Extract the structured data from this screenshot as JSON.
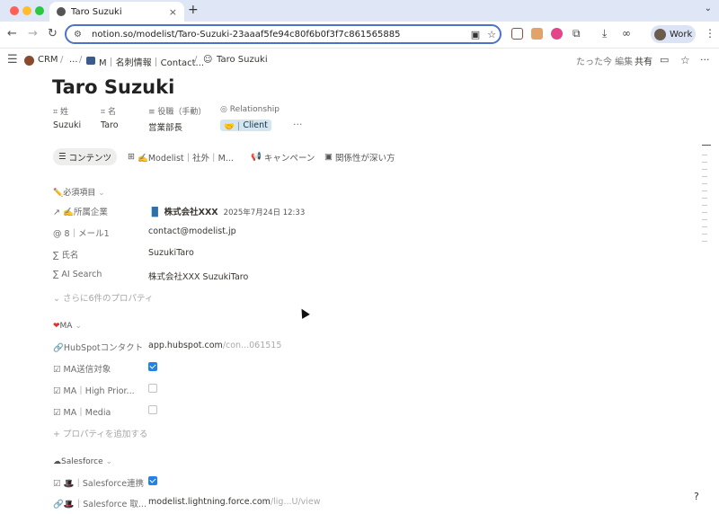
{
  "browser": {
    "tab_title": "Taro Suzuki",
    "tab_close": "×",
    "new_tab": "+",
    "tab_menu": "⌄",
    "url": "notion.so/modelist/Taro-Suzuki-23aaaf5fe94c80f6b0f3f7c861565885",
    "profile": "Work",
    "colors": {
      "chrome_bg": "#dfe7f6",
      "omnibox_border": "#4b73c9"
    }
  },
  "notion_topbar": {
    "crumbs": [
      "CRM",
      "...",
      "M｜名刺情報｜Contact...",
      "Taro Suzuki"
    ],
    "separators": [
      "/",
      "/",
      "/"
    ],
    "edited": "たった今 編集",
    "share": "共有"
  },
  "page": {
    "title": "Taro Suzuki",
    "prop_headers": [
      "姓",
      "名",
      "役職（手動）",
      "Relationship"
    ],
    "prop_values": [
      "Suzuki",
      "Taro",
      "営業部長"
    ],
    "relationship_tag": "Client",
    "more_menu": "···",
    "view_tabs": [
      "コンテンツ",
      "✍️Modelist｜社外｜M...",
      "キャンペーン",
      "関係性が深い方"
    ],
    "section_required": "必須項目",
    "required_rows": [
      {
        "label": "✍️所属企業",
        "value": "株式会社XXX",
        "extra": "2025年7月24日 12:33"
      },
      {
        "label": "8｜メール1",
        "value": "contact@modelist.jp"
      },
      {
        "label": "氏名",
        "value": "SuzukiTaro"
      },
      {
        "label": "AI Search",
        "value": "株式会社XXX SuzukiTaro"
      }
    ],
    "more_props": "さらに6件のプロパティ",
    "section_ma": "MA",
    "ma_url_label": "HubSpotコンタクト",
    "ma_url_value": "app.hubspot.com",
    "ma_url_rest": "/con...061515",
    "ma_checkboxes": [
      {
        "label": "MA送信対象",
        "checked": true
      },
      {
        "label": "MA｜High Prior...",
        "checked": false
      },
      {
        "label": "MA｜Media",
        "checked": false
      }
    ],
    "add_property": "プロパティを追加する",
    "section_sf": "Salesforce",
    "sf_checkbox_label": "｜Salesforce連携",
    "sf_url_label": "｜Salesforce 取...",
    "sf_url_value": "modelist.lightning.force.com",
    "sf_url_rest": "/lig...U/view",
    "help": "?"
  }
}
